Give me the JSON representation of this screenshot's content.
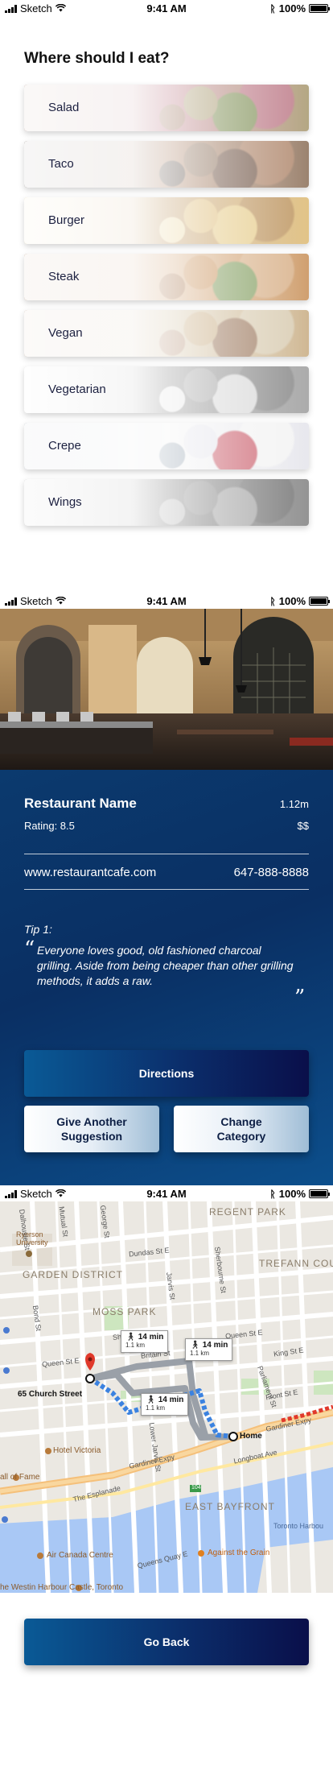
{
  "status_bar": {
    "carrier": "Sketch",
    "time": "9:41 AM",
    "battery": "100%"
  },
  "screen_categories": {
    "title": "Where should I eat?",
    "categories": [
      {
        "label": "Salad",
        "colors": [
          "#9b8a5a",
          "#6a7d3a",
          "#b06070",
          "#8a5a40"
        ]
      },
      {
        "label": "Taco",
        "colors": [
          "#7a5a40",
          "#5a3a28",
          "#a07050",
          "#3a2a20"
        ]
      },
      {
        "label": "Burger",
        "colors": [
          "#d8b060",
          "#e0c070",
          "#b08040",
          "#e8d090"
        ]
      },
      {
        "label": "Steak",
        "colors": [
          "#c08040",
          "#6a8a40",
          "#d0a070",
          "#9a6030"
        ]
      },
      {
        "label": "Vegan",
        "colors": [
          "#c0a070",
          "#8a6040",
          "#d0c0a0",
          "#aa8060"
        ]
      },
      {
        "label": "Vegetarian",
        "colors": [
          "#909090",
          "#d0d0d0",
          "#707070",
          "#e0e0e0"
        ]
      },
      {
        "label": "Crepe",
        "colors": [
          "#e0e0e8",
          "#c04050",
          "#f0f0f0",
          "#8090a0"
        ]
      },
      {
        "label": "Wings",
        "colors": [
          "#707070",
          "#909090",
          "#5a5a5a",
          "#a0a0a0"
        ]
      }
    ]
  },
  "screen_restaurant": {
    "name": "Restaurant Name",
    "distance": "1.12m",
    "rating": "Rating: 8.5",
    "price": "$$",
    "website": "www.restaurantcafe.com",
    "phone": "647-888-8888",
    "tip_heading": "Tip 1:",
    "tip_open_quote": "“",
    "tip_text": "Everyone loves good, old fashioned charcoal grilling. Aside from being cheaper than other grilling methods, it adds a raw.",
    "tip_close_quote": "”",
    "directions_label": "Directions",
    "another_label": "Give Another Suggestion",
    "change_label": "Change Category"
  },
  "screen_map": {
    "labels": {
      "ryerson": "Ryerson University",
      "garden_district": "GARDEN DISTRICT",
      "trefann": "TREFANN COU",
      "regent_park": "REGENT PARK",
      "moss_park": "MOSS PARK",
      "church_street": "65 Church Street",
      "home": "Home",
      "hotel_victoria": "Hotel Victoria",
      "hall_of_fame": "all of Fame",
      "east_bayfront": "EAST BAYFRONT",
      "air_canada": "Air Canada Centre",
      "against_grain": "Against the Grain",
      "toronto_harbour": "Toronto Harbou",
      "westin": "he Westin Harbour Castle, Toronto",
      "gardiner1": "Gardiner Expy",
      "gardiner2": "Gardiner Expy",
      "esplanade": "The Esplanade",
      "queens_quay": "Queens Quay E",
      "dundas": "Dundas St E",
      "shuter": "Shuter St",
      "queen": "Queen St E",
      "king": "King St E",
      "lower_jarvis": "Lower Jarvis St",
      "jarvis": "Jarvis St",
      "sherbourne": "Sherbourne St",
      "parliament": "Parliament St",
      "front": "Front St E",
      "richmond": "Richmond St E",
      "adelaide": "Adelaide St E",
      "george": "George St",
      "dalhousie": "Dalhousie St",
      "bond": "Bond St",
      "mutual": "Mutual St",
      "britain": "Britain St",
      "gerrard": "Gerrard St",
      "longboat": "Longboat Ave",
      "highway": "104"
    },
    "walk_boxes": [
      {
        "time": "14 min",
        "dist": "1.1 km"
      },
      {
        "time": "14 min",
        "dist": "1.1 km"
      },
      {
        "time": "14 min",
        "dist": "1.1 km"
      }
    ],
    "go_back_label": "Go Back"
  },
  "colors": {
    "accent_dark": "#0b2e6b",
    "route_blue": "#3b82e0",
    "pin_red": "#e0392b"
  }
}
